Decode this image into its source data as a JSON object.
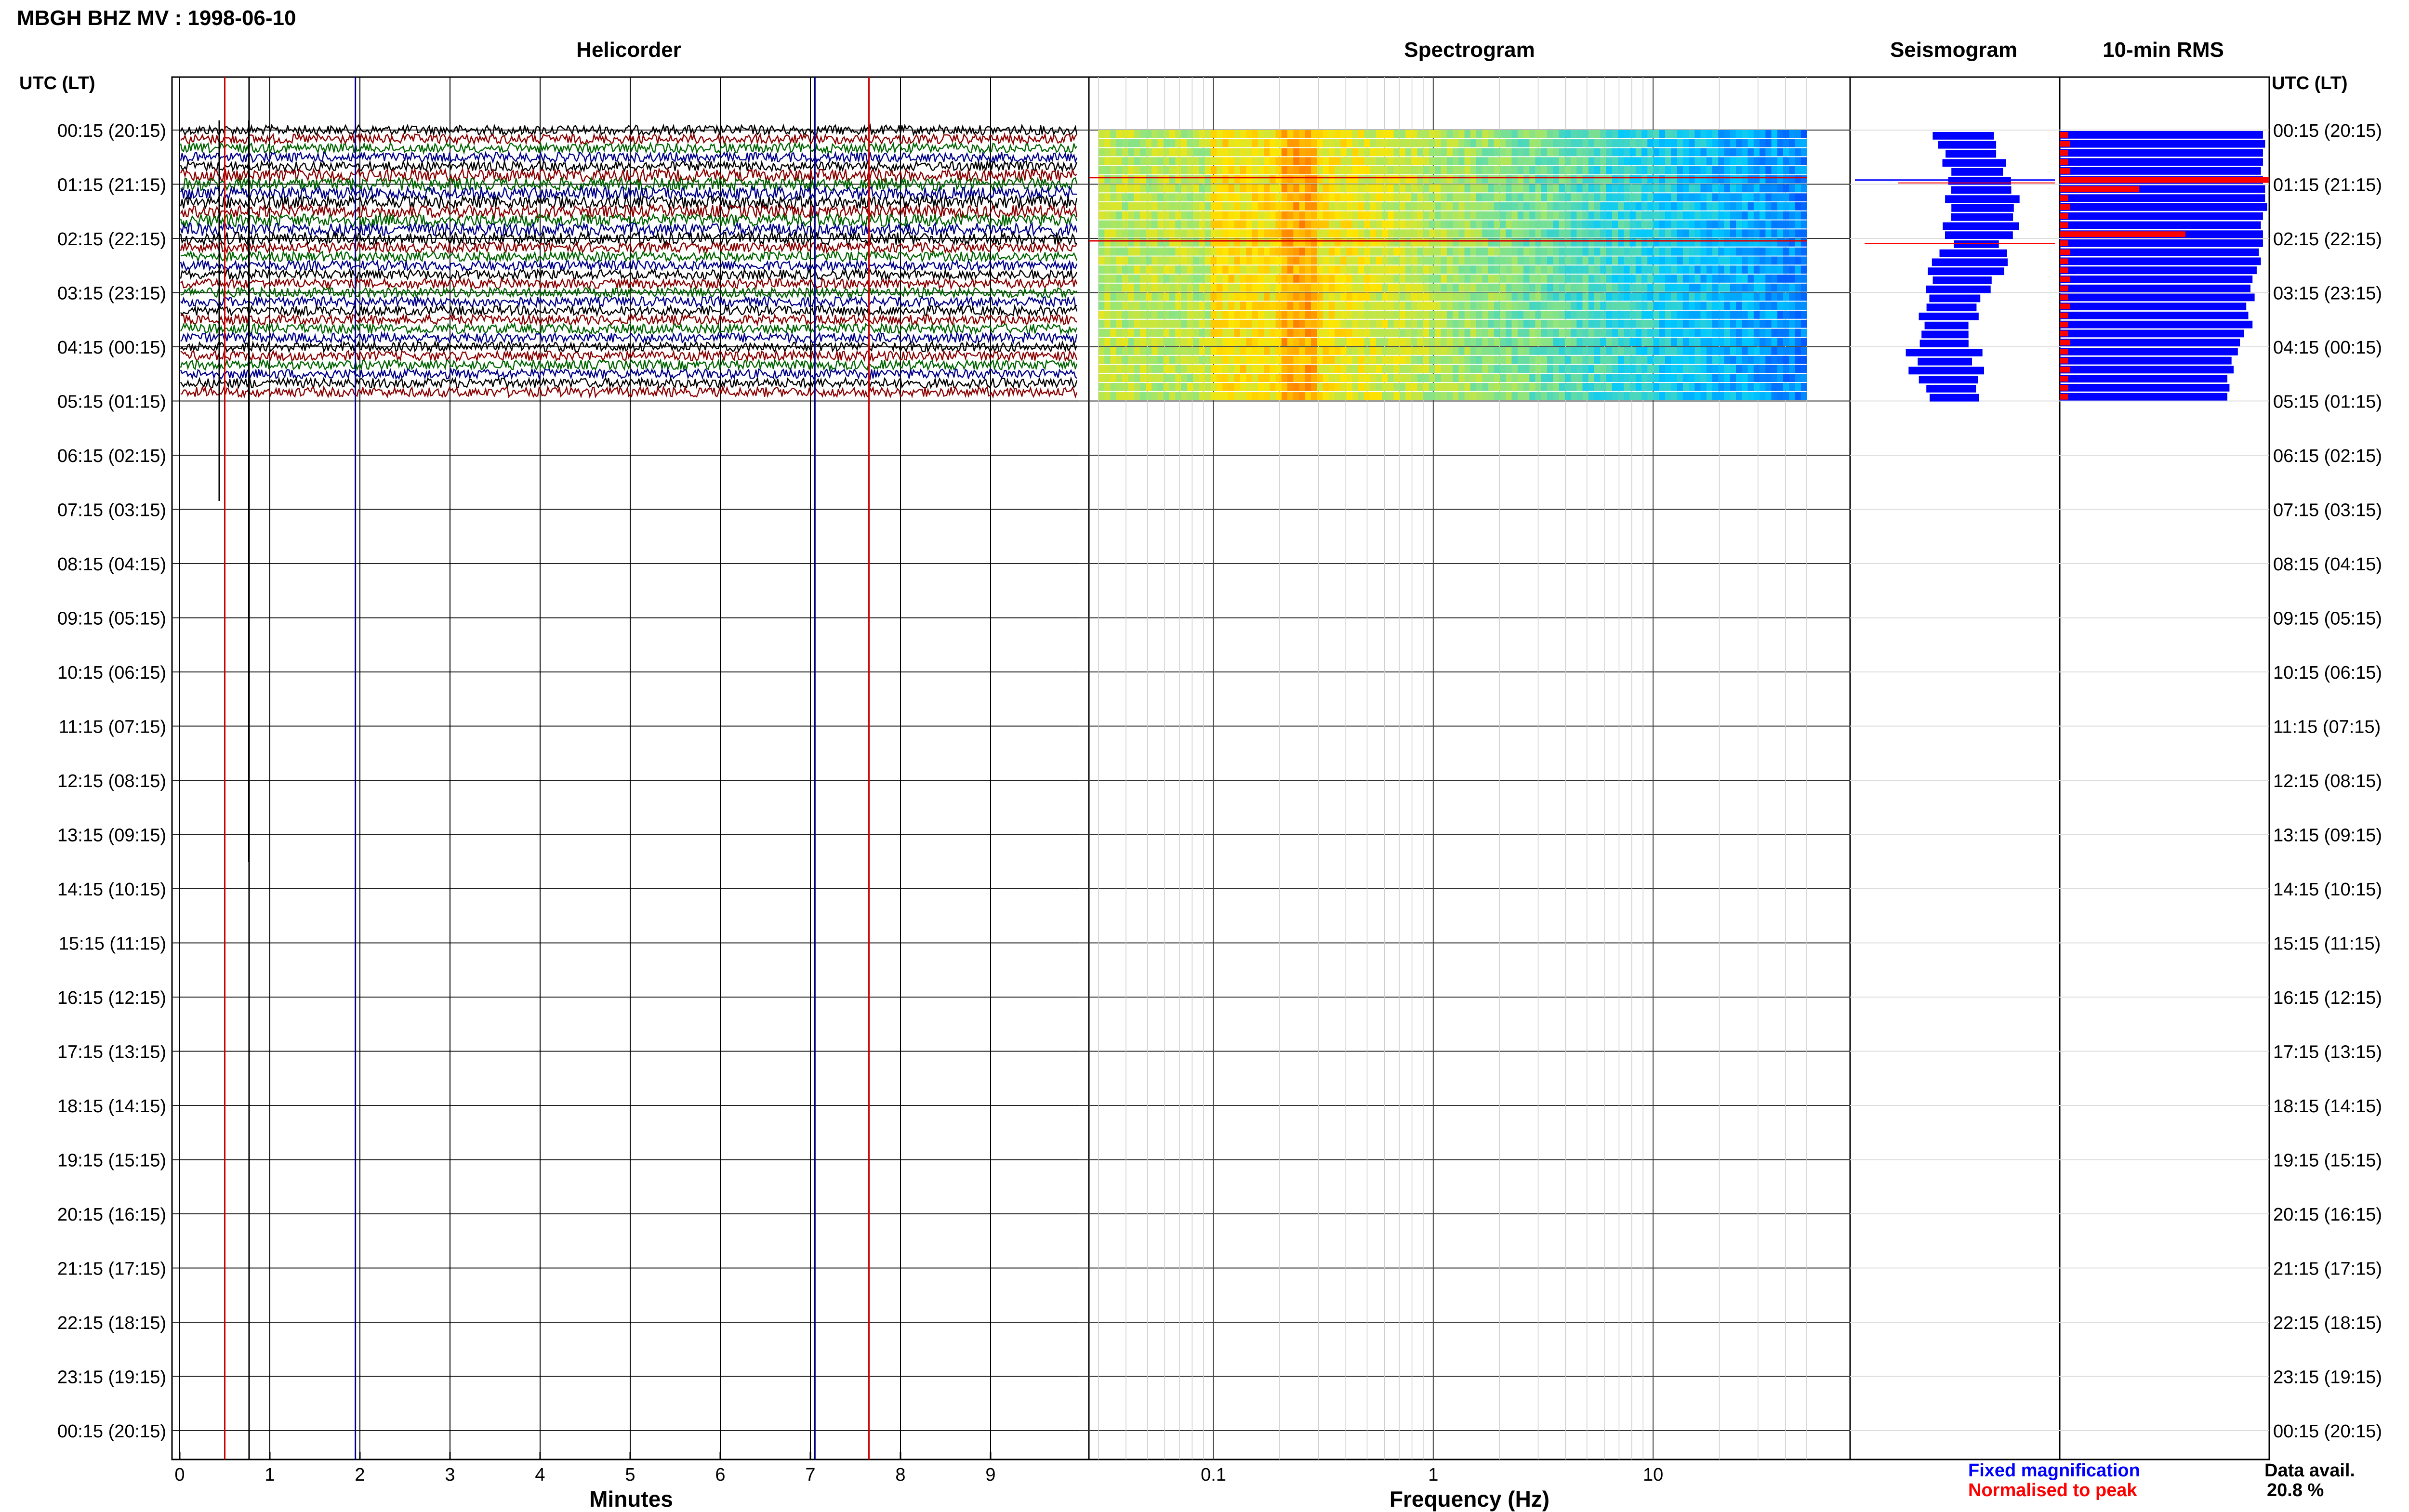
{
  "title": "MBGH BHZ MV : 1998-06-10",
  "panels": {
    "helicorder": "Helicorder",
    "spectrogram": "Spectrogram",
    "seismogram": "Seismogram",
    "rms": "10-min RMS"
  },
  "time_axis_header": "UTC (LT)",
  "time_labels": [
    "00:15 (20:15)",
    "01:15 (21:15)",
    "02:15 (22:15)",
    "03:15 (23:15)",
    "04:15 (00:15)",
    "05:15 (01:15)",
    "06:15 (02:15)",
    "07:15 (03:15)",
    "08:15 (04:15)",
    "09:15 (05:15)",
    "10:15 (06:15)",
    "11:15 (07:15)",
    "12:15 (08:15)",
    "13:15 (09:15)",
    "14:15 (10:15)",
    "15:15 (11:15)",
    "16:15 (12:15)",
    "17:15 (13:15)",
    "18:15 (14:15)",
    "19:15 (15:15)",
    "20:15 (16:15)",
    "21:15 (17:15)",
    "22:15 (18:15)",
    "23:15 (19:15)",
    "00:15 (20:15)"
  ],
  "helicorder_axis": {
    "xlabel": "Minutes",
    "ticks": [
      "0",
      "1",
      "2",
      "3",
      "4",
      "5",
      "6",
      "7",
      "8",
      "9"
    ]
  },
  "spectrogram_axis": {
    "xlabel": "Frequency (Hz)",
    "scale": "log",
    "ticks": [
      "0.1",
      "1",
      "10"
    ]
  },
  "legend": {
    "fixed": "Fixed magnification",
    "normalised": "Normalised to peak",
    "fixed_color": "#0000ff",
    "normalised_color": "#ff0000"
  },
  "data_availability": {
    "label": "Data avail.",
    "value": "20.8 %"
  },
  "colors": {
    "trace_cycle": [
      "#000000",
      "#8b0000",
      "#006400",
      "#00008b"
    ],
    "rms_fixed": "#0000ff",
    "rms_normalised": "#ff0000"
  },
  "chart_data": [
    {
      "type": "line",
      "panel": "Helicorder",
      "xlabel": "Minutes",
      "xlim": [
        0,
        10
      ],
      "rows_with_data": 30,
      "rows_total": 144,
      "marker_lines_minutes": [
        {
          "minute": 0.5,
          "color": "red"
        },
        {
          "minute": 0.77,
          "color": "black"
        },
        {
          "minute": 1.95,
          "color": "blue"
        },
        {
          "minute": 7.05,
          "color": "blue"
        },
        {
          "minute": 7.65,
          "color": "red"
        }
      ]
    },
    {
      "type": "heatmap",
      "panel": "Spectrogram",
      "xlabel": "Frequency (Hz)",
      "xscale": "log",
      "xlim": [
        0.03,
        50
      ],
      "data_rows": 30,
      "peak_band_hz": [
        0.2,
        0.3
      ]
    },
    {
      "type": "line",
      "panel": "Seismogram",
      "data_rows": 30
    },
    {
      "type": "bar",
      "panel": "10-min RMS",
      "orientation": "horizontal",
      "rms_fixed": [
        0.97,
        0.98,
        0.97,
        0.97,
        0.96,
        0.97,
        0.98,
        0.98,
        0.99,
        0.97,
        0.96,
        0.97,
        0.97,
        0.95,
        0.96,
        0.94,
        0.92,
        0.91,
        0.93,
        0.89,
        0.9,
        0.92,
        0.88,
        0.86,
        0.85,
        0.82,
        0.83,
        0.8,
        0.81,
        0.8
      ],
      "rms_normalised": [
        0.04,
        0.05,
        0.04,
        0.04,
        0.05,
        1.0,
        0.38,
        0.04,
        0.05,
        0.04,
        0.04,
        0.6,
        0.04,
        0.05,
        0.04,
        0.04,
        0.05,
        0.04,
        0.04,
        0.05,
        0.04,
        0.04,
        0.04,
        0.05,
        0.04,
        0.04,
        0.05,
        0.04,
        0.04,
        0.04
      ]
    }
  ]
}
